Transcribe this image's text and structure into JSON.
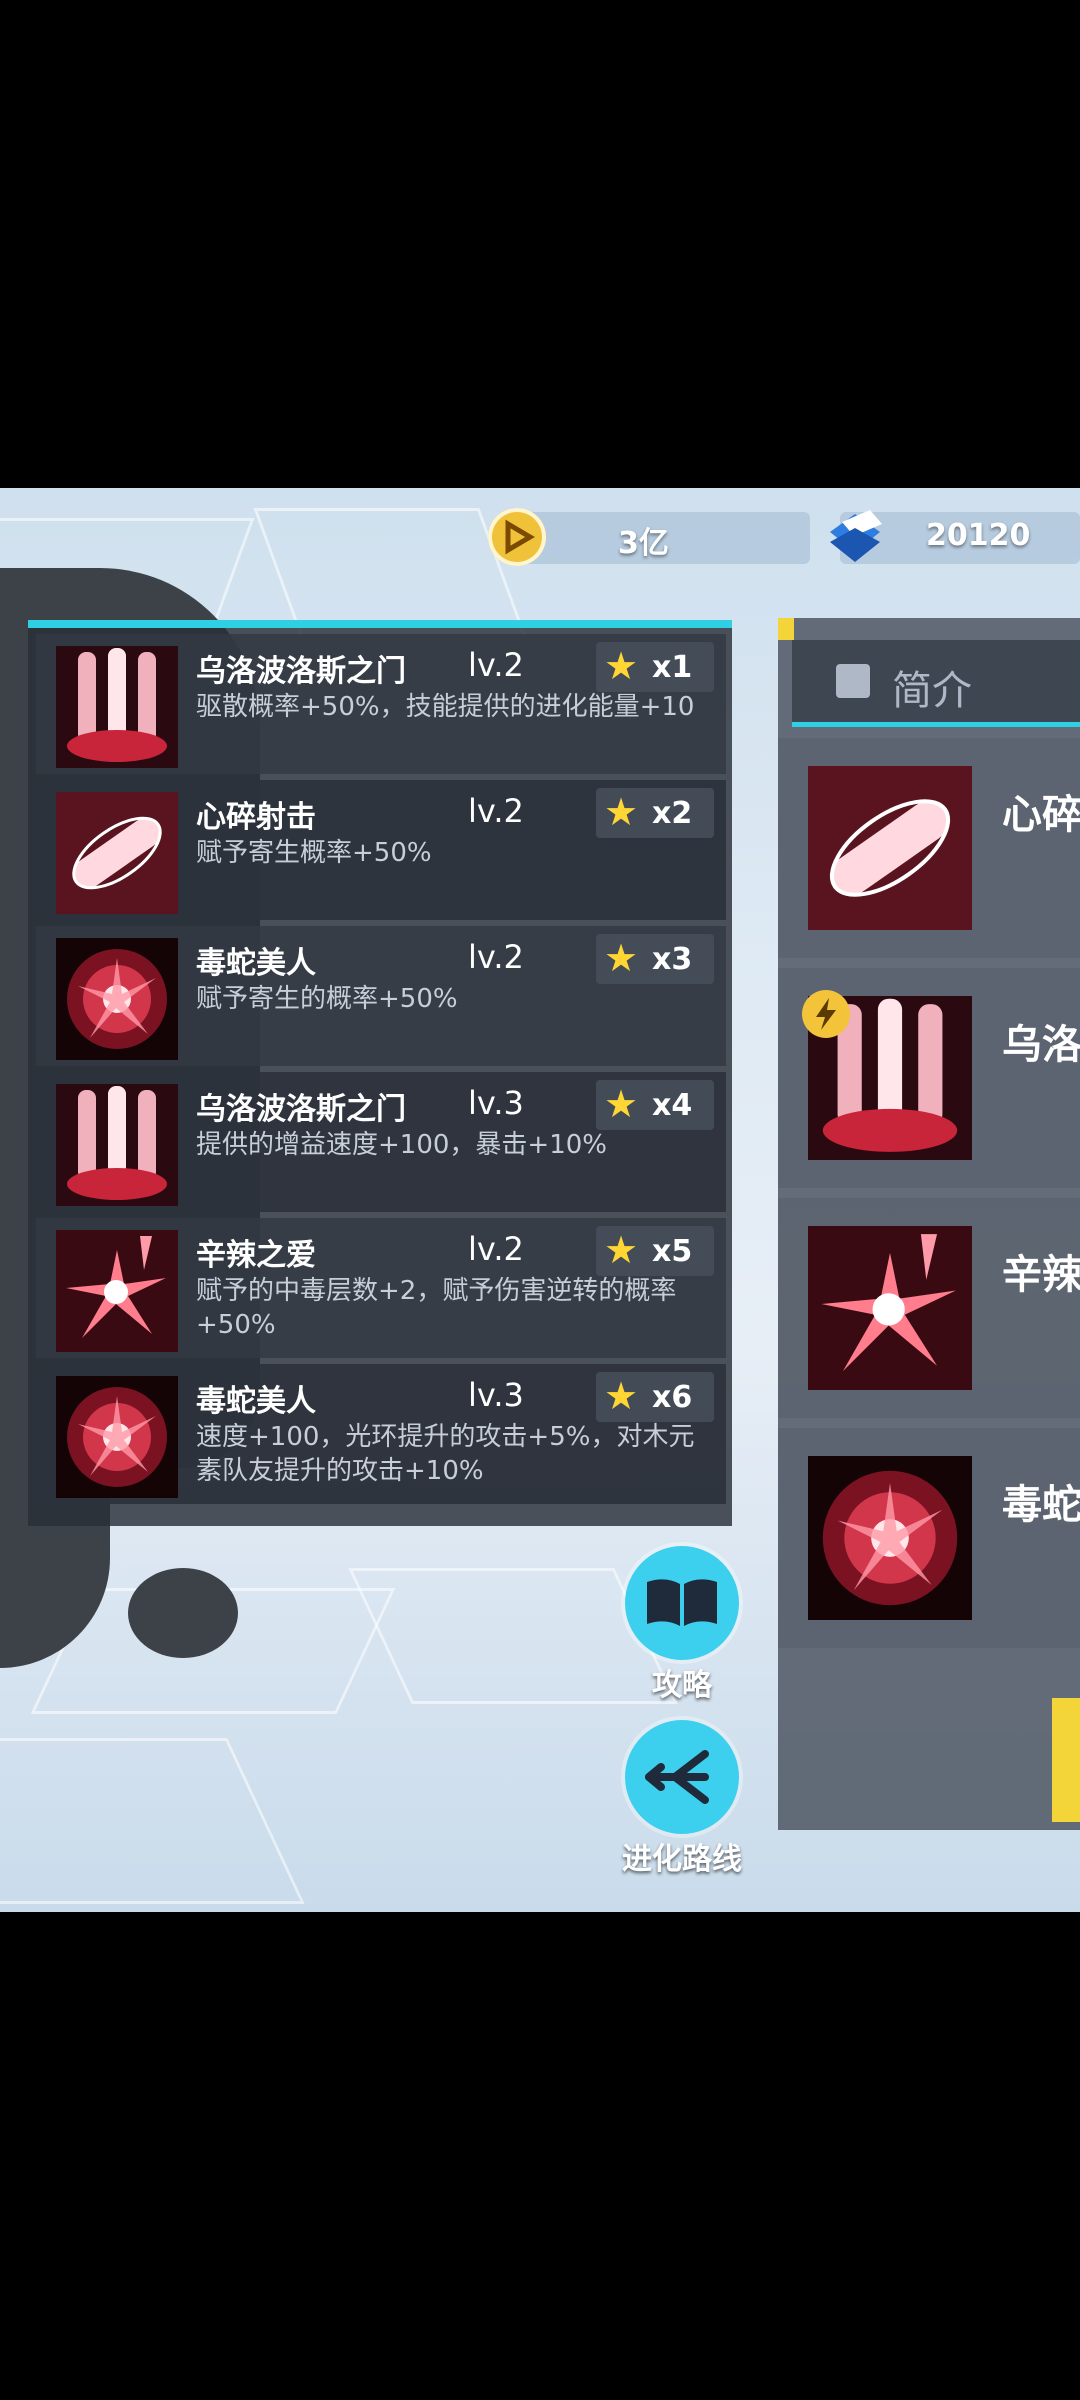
{
  "header": {
    "coin_value": "3亿",
    "gem_value": "20120"
  },
  "skills": [
    {
      "name": "乌洛波洛斯之门",
      "level": "lv.2",
      "count": "x1",
      "desc": "驱散概率+50%，技能提供的进化能量+10",
      "icon": "claw-strike-icon"
    },
    {
      "name": "心碎射击",
      "level": "lv.2",
      "count": "x2",
      "desc": "赋予寄生概率+50%",
      "icon": "piercing-shot-icon"
    },
    {
      "name": "毒蛇美人",
      "level": "lv.2",
      "count": "x3",
      "desc": "赋予寄生的概率+50%",
      "icon": "venom-burst-icon"
    },
    {
      "name": "乌洛波洛斯之门",
      "level": "lv.3",
      "count": "x4",
      "desc": "提供的增益速度+100，暴击+10%",
      "icon": "claw-strike-icon"
    },
    {
      "name": "辛辣之爱",
      "level": "lv.2",
      "count": "x5",
      "desc": "赋予的中毒层数+2，赋予伤害逆转的概率+50%",
      "icon": "spark-burst-icon"
    },
    {
      "name": "毒蛇美人",
      "level": "lv.3",
      "count": "x6",
      "desc": "速度+100，光环提升的攻击+5%，对木元素队友提升的攻击+10%",
      "icon": "venom-burst-icon"
    }
  ],
  "buttons": {
    "guide_label": "攻略",
    "evolution_label": "进化路线"
  },
  "right_panel": {
    "tab_label": "简介",
    "cards": [
      {
        "name": "心碎",
        "icon": "piercing-shot-icon"
      },
      {
        "name": "乌洛",
        "icon": "claw-strike-icon",
        "badge": "lightning-icon"
      },
      {
        "name": "辛辣",
        "icon": "spark-burst-icon"
      },
      {
        "name": "毒蛇",
        "icon": "venom-burst-icon"
      }
    ]
  },
  "colors": {
    "accent": "#2fd0e3",
    "star": "#ffd633",
    "skill_red": "#e23a4e"
  }
}
